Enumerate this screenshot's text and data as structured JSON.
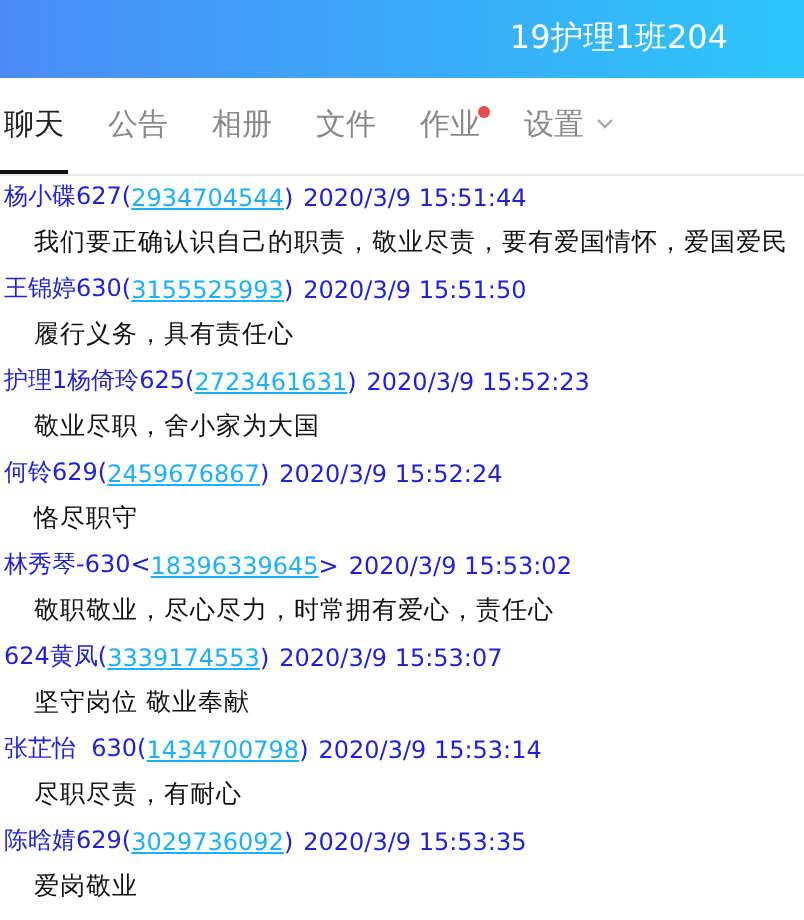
{
  "header": {
    "title": "19护理1班204"
  },
  "tabs": [
    {
      "label": "聊天",
      "selected": true,
      "badge": false,
      "menu": false
    },
    {
      "label": "公告",
      "selected": false,
      "badge": false,
      "menu": false
    },
    {
      "label": "相册",
      "selected": false,
      "badge": false,
      "menu": false
    },
    {
      "label": "文件",
      "selected": false,
      "badge": false,
      "menu": false
    },
    {
      "label": "作业",
      "selected": false,
      "badge": true,
      "menu": false
    },
    {
      "label": "设置",
      "selected": false,
      "badge": false,
      "menu": true
    }
  ],
  "messages": [
    {
      "sender": "杨小碟627(",
      "qq": "2934704544",
      "after": ")",
      "time": "2020/3/9 15:51:44",
      "text": "我们要正确认识自己的职责，敬业尽责，要有爱国情怀，爱国爱民"
    },
    {
      "sender": "王锦婷630(",
      "qq": "3155525993",
      "after": ")",
      "time": "2020/3/9 15:51:50",
      "text": "履行义务，具有责任心"
    },
    {
      "sender": "护理1杨倚玲625(",
      "qq": "2723461631",
      "after": ")",
      "time": "2020/3/9 15:52:23",
      "text": "敬业尽职，舍小家为大国"
    },
    {
      "sender": "何铃629(",
      "qq": "2459676867",
      "after": ")",
      "time": "2020/3/9 15:52:24",
      "text": "恪尽职守"
    },
    {
      "sender": "林秀琴-630<",
      "qq": "18396339645",
      "after": ">",
      "time": "2020/3/9 15:53:02",
      "text": "敬职敬业，尽心尽力，时常拥有爱心，责任心"
    },
    {
      "sender": "624黄凤(",
      "qq": "3339174553",
      "after": ")",
      "time": "2020/3/9 15:53:07",
      "text": "坚守岗位 敬业奉献"
    },
    {
      "sender": "张芷怡  630(",
      "qq": "1434700798",
      "after": ")",
      "time": "2020/3/9 15:53:14",
      "text": "尽职尽责，有耐心"
    },
    {
      "sender": "陈晗婧629(",
      "qq": "3029736092",
      "after": ")",
      "time": "2020/3/9 15:53:35",
      "text": "爱岗敬业"
    }
  ]
}
